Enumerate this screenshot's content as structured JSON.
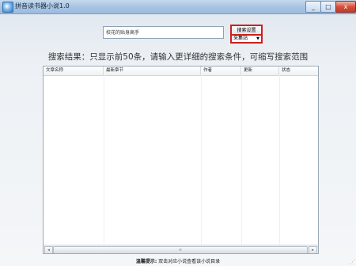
{
  "window": {
    "title": "拼音读书器小说1.0",
    "min_glyph": "_",
    "max_glyph": "□",
    "close_glyph": "x"
  },
  "search": {
    "input_value": "校花的贴身高手",
    "button_label": "搜索设置",
    "mode_value": "采集站",
    "mode_arrow": "▼"
  },
  "results": {
    "note": "搜索结果：只显示前50条，请输入更详细的搜索条件，可缩写搜索范围",
    "columns": [
      "文章名称",
      "最新章节",
      "作者",
      "更新",
      "状态"
    ]
  },
  "scrollbar": {
    "left_arrow": "◂",
    "right_arrow": "▸",
    "thumb_glyph": "≡"
  },
  "footer": {
    "tip_label": "温馨提示:",
    "tip_text": "双击对应小说查看该小说目录"
  }
}
